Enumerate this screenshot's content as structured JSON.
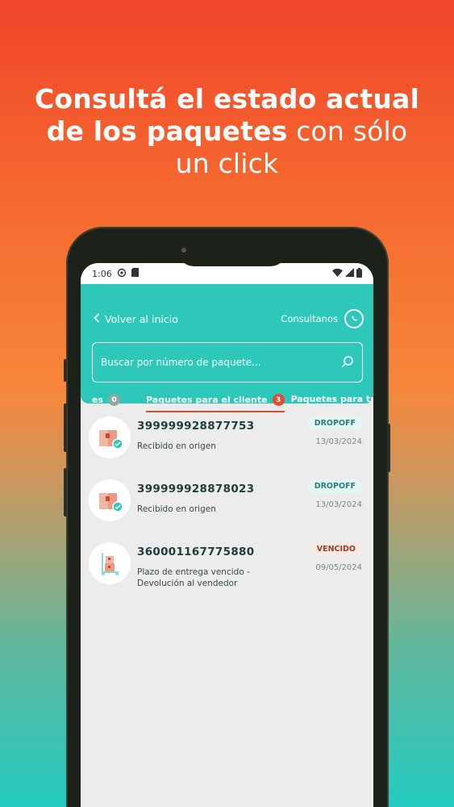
{
  "headline": {
    "line1_bold": "Consultá el estado actual",
    "line2_bold": "de los paquetes",
    "line2_normal": "con sólo",
    "line3_normal": "un click"
  },
  "statusbar": {
    "time": "1:06"
  },
  "appbar": {
    "back_label": "Volver al inicio",
    "contact_label": "Consultanos",
    "search_placeholder": "Buscar por número de paquete..."
  },
  "tabs": [
    {
      "label": "es",
      "count": "0"
    },
    {
      "label": "Paquetes para el cliente",
      "count": "3"
    },
    {
      "label": "Paquetes para tra",
      "count": ""
    }
  ],
  "packages": [
    {
      "id": "399999928877753",
      "status": "Recibido en origen",
      "tag": "DROPOFF",
      "date": "13/03/2024"
    },
    {
      "id": "399999928878023",
      "status": "Recibido en origen",
      "tag": "DROPOFF",
      "date": "13/03/2024"
    },
    {
      "id": "360001167775880",
      "status": "Plazo de entrega vencido - Devolución al vendedor",
      "tag": "VENCIDO",
      "date": "09/05/2024"
    }
  ],
  "colors": {
    "accent": "#2ec8bb",
    "alert": "#e64a2e",
    "brand_gradient_top": "#f0452a"
  }
}
